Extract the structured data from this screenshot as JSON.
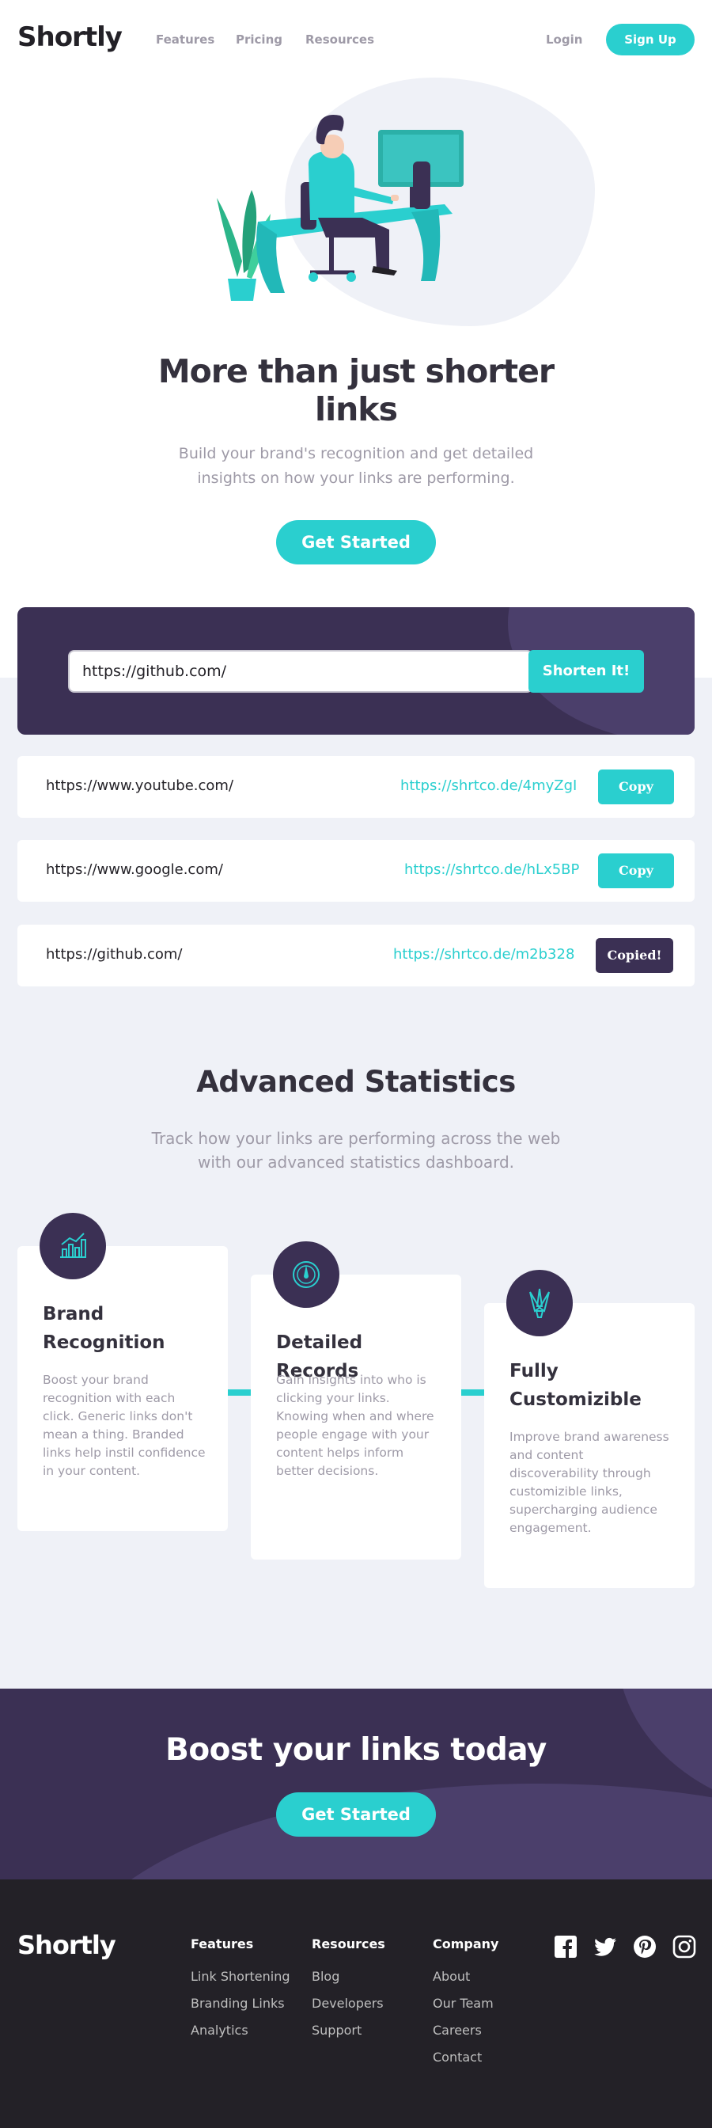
{
  "header": {
    "logo": "Shortly",
    "nav": [
      "Features",
      "Pricing",
      "Resources"
    ],
    "login": "Login",
    "signup": "Sign Up"
  },
  "hero": {
    "title": "More than just shorter links",
    "subtitle": "Build your brand's recognition and get detailed insights on how your links are performing.",
    "cta": "Get Started"
  },
  "shorten": {
    "input_value": "https://github.com/",
    "button": "Shorten It!"
  },
  "results": [
    {
      "original": "https://www.youtube.com/",
      "short": "https://shrtco.de/4myZgI",
      "button": "Copy",
      "copied": false
    },
    {
      "original": "https://www.google.com/",
      "short": "https://shrtco.de/hLx5BP",
      "button": "Copy",
      "copied": false
    },
    {
      "original": "https://github.com/",
      "short": "https://shrtco.de/m2b328",
      "button": "Copied!",
      "copied": true
    }
  ],
  "stats": {
    "title": "Advanced Statistics",
    "subtitle": "Track how your links are performing across the web with our advanced statistics dashboard.",
    "cards": [
      {
        "icon": "chart-icon",
        "title": "Brand Recognition",
        "text": "Boost your brand recognition with each click. Generic links don't mean a thing. Branded links help instil confidence in your content."
      },
      {
        "icon": "gauge-icon",
        "title": "Detailed Records",
        "text": "Gain insights into who is clicking your links. Knowing when and where people engage with your content helps inform better decisions."
      },
      {
        "icon": "brush-icon",
        "title": "Fully Customizible",
        "text": "Improve brand awareness and content discoverability through customizible links, supercharging audience engagement."
      }
    ]
  },
  "boost": {
    "title": "Boost your links today",
    "cta": "Get Started"
  },
  "footer": {
    "logo": "Shortly",
    "columns": [
      {
        "heading": "Features",
        "links": [
          "Link Shortening",
          "Branding Links",
          "Analytics"
        ]
      },
      {
        "heading": "Resources",
        "links": [
          "Blog",
          "Developers",
          "Support"
        ]
      },
      {
        "heading": "Company",
        "links": [
          "About",
          "Our Team",
          "Careers",
          "Contact"
        ]
      }
    ],
    "social": [
      "facebook-icon",
      "twitter-icon",
      "pinterest-icon",
      "instagram-icon"
    ]
  },
  "colors": {
    "primary_cyan": "#2acfcf",
    "dark_violet": "#3b3054",
    "grey_bg": "#eff1f7",
    "very_dark": "#232127"
  }
}
